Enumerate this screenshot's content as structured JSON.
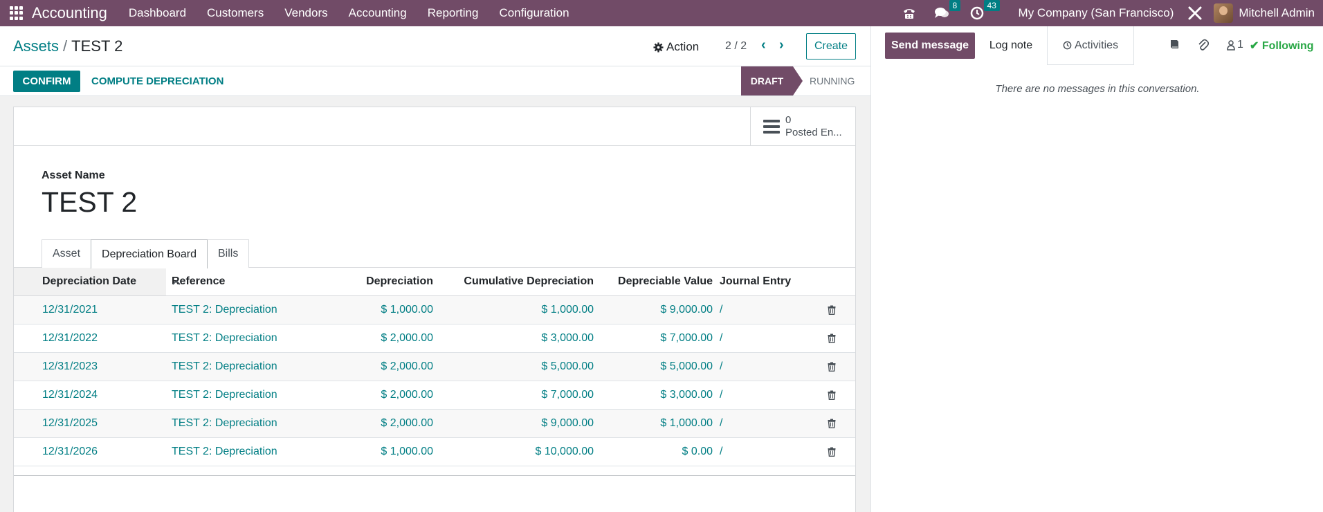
{
  "navbar": {
    "app_name": "Accounting",
    "menu": [
      "Dashboard",
      "Customers",
      "Vendors",
      "Accounting",
      "Reporting",
      "Configuration"
    ],
    "messages_count": "8",
    "activities_count": "43",
    "company": "My Company (San Francisco)",
    "user": "Mitchell Admin"
  },
  "breadcrumb": {
    "parent": "Assets",
    "current": "TEST 2"
  },
  "control": {
    "action_label": "Action",
    "pager": "2 / 2",
    "create_label": "Create"
  },
  "statusbar": {
    "confirm_label": "CONFIRM",
    "compute_label": "COMPUTE DEPRECIATION",
    "stages": [
      "DRAFT",
      "RUNNING"
    ],
    "active_stage": "DRAFT"
  },
  "stat_button": {
    "value": "0",
    "label": "Posted En..."
  },
  "form": {
    "name_label": "Asset Name",
    "name": "TEST 2"
  },
  "tabs": [
    "Asset",
    "Depreciation Board",
    "Bills"
  ],
  "active_tab": "Depreciation Board",
  "table": {
    "columns": [
      "Depreciation Date",
      "Reference",
      "Depreciation",
      "Cumulative Depreciation",
      "Depreciable Value",
      "Journal Entry"
    ],
    "rows": [
      {
        "date": "12/31/2021",
        "ref": "TEST 2: Depreciation",
        "dep": "$ 1,000.00",
        "cum": "$ 1,000.00",
        "val": "$ 9,000.00",
        "je": "/"
      },
      {
        "date": "12/31/2022",
        "ref": "TEST 2: Depreciation",
        "dep": "$ 2,000.00",
        "cum": "$ 3,000.00",
        "val": "$ 7,000.00",
        "je": "/"
      },
      {
        "date": "12/31/2023",
        "ref": "TEST 2: Depreciation",
        "dep": "$ 2,000.00",
        "cum": "$ 5,000.00",
        "val": "$ 5,000.00",
        "je": "/"
      },
      {
        "date": "12/31/2024",
        "ref": "TEST 2: Depreciation",
        "dep": "$ 2,000.00",
        "cum": "$ 7,000.00",
        "val": "$ 3,000.00",
        "je": "/"
      },
      {
        "date": "12/31/2025",
        "ref": "TEST 2: Depreciation",
        "dep": "$ 2,000.00",
        "cum": "$ 9,000.00",
        "val": "$ 1,000.00",
        "je": "/"
      },
      {
        "date": "12/31/2026",
        "ref": "TEST 2: Depreciation",
        "dep": "$ 1,000.00",
        "cum": "$ 10,000.00",
        "val": "$ 0.00",
        "je": "/"
      }
    ]
  },
  "chatter": {
    "send_label": "Send message",
    "log_label": "Log note",
    "activities_label": "Activities",
    "followers_count": "1",
    "following_label": "Following",
    "empty_text": "There are no messages in this conversation."
  },
  "colors": {
    "brand": "#714B67",
    "accent": "#017E84",
    "following": "#28a745"
  }
}
